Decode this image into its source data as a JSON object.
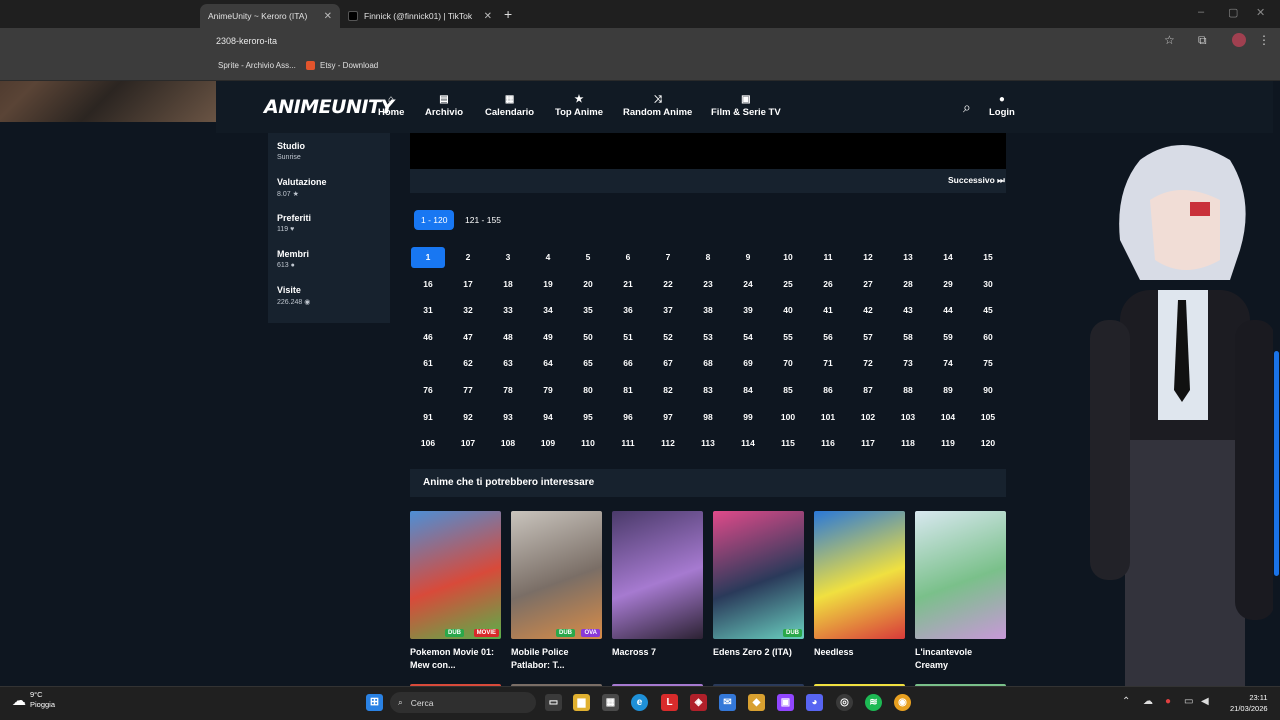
{
  "browser": {
    "tabs": [
      {
        "label": "AnimeUnity ~ Keroro (ITA) Stre",
        "active": true
      },
      {
        "label": "Finnick (@finnick01) | TikTok",
        "active": false
      }
    ],
    "url": "2308-keroro-ita",
    "bookmarks": [
      "Sprite - Archivio Ass...",
      "Etsy - Download"
    ]
  },
  "site": {
    "logo": "ANIMEUNITY",
    "nav": [
      {
        "label": "Home",
        "icon": "⌂"
      },
      {
        "label": "Archivio",
        "icon": "▤"
      },
      {
        "label": "Calendario",
        "icon": "▦"
      },
      {
        "label": "Top Anime",
        "icon": "★"
      },
      {
        "label": "Random Anime",
        "icon": "⤨"
      },
      {
        "label": "Film & Serie TV",
        "icon": "▣"
      }
    ],
    "login": "Login"
  },
  "sidebar": {
    "stats": [
      {
        "label": "Studio",
        "value": "Sunrise"
      },
      {
        "label": "Valutazione",
        "value": "8.07 ★"
      },
      {
        "label": "Preferiti",
        "value": "119 ♥"
      },
      {
        "label": "Membri",
        "value": "613 ●"
      },
      {
        "label": "Visite",
        "value": "226.248 ◉"
      }
    ]
  },
  "player": {
    "next_label": "Successivo ⏭"
  },
  "episodes": {
    "ranges": [
      {
        "label": "1 - 120",
        "active": true
      },
      {
        "label": "121 - 155",
        "active": false
      }
    ],
    "current": 1,
    "total_shown": 120
  },
  "suggestions": {
    "title": "Anime che ti potrebbero interessare",
    "items": [
      {
        "title": "Pokemon Movie 01: Mew con...",
        "badges": [
          "DUB",
          "MOVIE"
        ],
        "colors": [
          "#4d8fd6",
          "#d84a3a",
          "#59b04a"
        ]
      },
      {
        "title": "Mobile Police Patlabor: T...",
        "badges": [
          "DUB",
          "OVA"
        ],
        "colors": [
          "#c9c4bd",
          "#7a6e66",
          "#d88c48"
        ]
      },
      {
        "title": "Macross 7",
        "badges": [],
        "colors": [
          "#4a3a6a",
          "#a67ad0",
          "#2c2233"
        ]
      },
      {
        "title": "Edens Zero 2 (ITA)",
        "badges": [
          "DUB"
        ],
        "colors": [
          "#e04a8a",
          "#2a3a5a",
          "#6ad0c0"
        ]
      },
      {
        "title": "Needless",
        "badges": [],
        "colors": [
          "#2a78d8",
          "#f0e040",
          "#d83a3a"
        ]
      },
      {
        "title": "L'incantevole Creamy",
        "badges": [],
        "colors": [
          "#d8e8f0",
          "#7ac08a",
          "#c898d8"
        ]
      }
    ]
  },
  "taskbar": {
    "weather_temp": "9°C",
    "weather_desc": "Pioggia",
    "search": "Cerca",
    "time": "23:11",
    "date": "21/03/2026"
  }
}
